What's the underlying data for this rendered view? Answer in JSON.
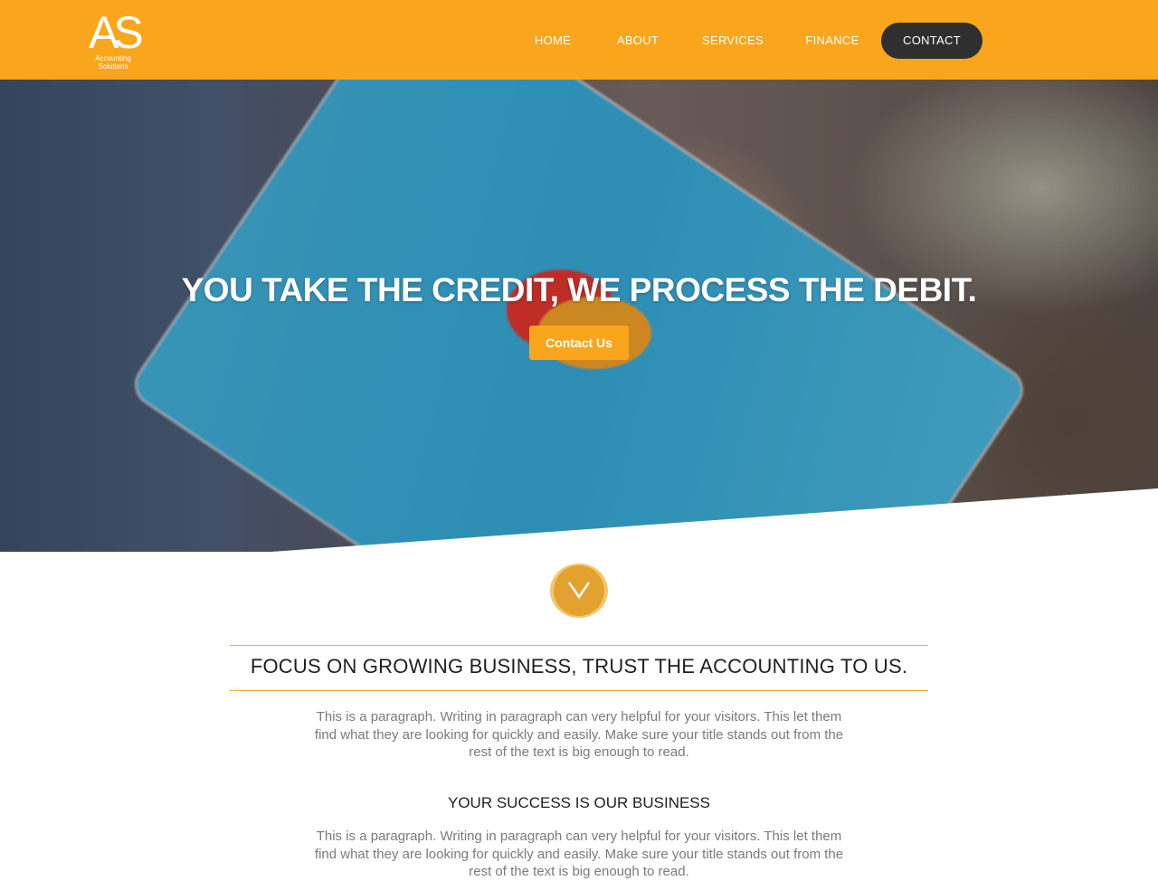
{
  "header": {
    "logo": {
      "mark": "AS",
      "line1": "Accounting",
      "line2": "Solutions"
    },
    "nav": [
      {
        "label": "HOME"
      },
      {
        "label": "ABOUT"
      },
      {
        "label": "SERVICES"
      },
      {
        "label": "FINANCE"
      },
      {
        "label": "CONTACT"
      }
    ]
  },
  "hero": {
    "title": "YOU TAKE THE CREDIT, WE PROCESS THE DEBIT.",
    "button_label": "Contact Us"
  },
  "scroll_icon": "chevron-down-icon",
  "main": {
    "heading": "FOCUS ON GROWING BUSINESS, TRUST THE ACCOUNTING TO US.",
    "paragraph1": "This is a paragraph. Writing in paragraph can very helpful for your visitors. This let them find what they are looking for quickly and easily. Make sure your title stands out from the rest of the text is big enough to read.",
    "subheading": "YOUR SUCCESS IS OUR BUSINESS",
    "paragraph2": "This is a paragraph. Writing in paragraph can very helpful for your visitors. This let them find what they are looking for quickly and easily. Make sure your title stands out from the rest of the text is big enough to read."
  },
  "colors": {
    "brand_orange": "#f9a61c",
    "contact_button": "#2f2f2f",
    "rule": "#f0a830",
    "scroll_circle": "#e3a12f"
  }
}
